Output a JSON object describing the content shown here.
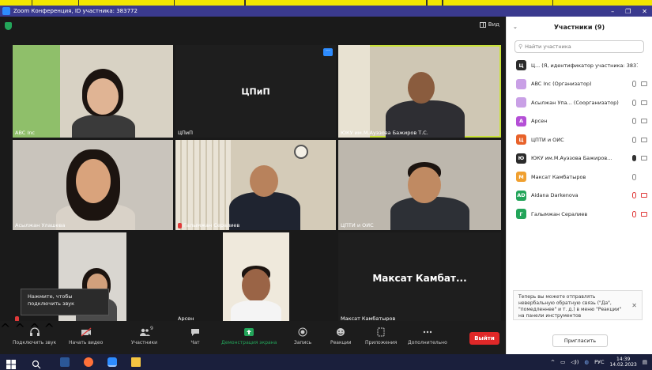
{
  "window": {
    "title": "Zoom Конференция, ID участника: 383772",
    "min": "–",
    "restore": "❐",
    "close": "✕"
  },
  "toolbar_top": {
    "view_label": "Вид"
  },
  "tiles": [
    {
      "name": "ABC Inc"
    },
    {
      "name": "ЦПиП",
      "big_label": "ЦПиП"
    },
    {
      "name": "ЮКУ  им.М.Ауэзова  Бажиров Т.С."
    },
    {
      "name": "Асылжан Улашева"
    },
    {
      "name": "Галымжан Сералиев"
    },
    {
      "name": "ЦПТИ и ОИС"
    },
    {
      "name": ""
    },
    {
      "name": "Арсен"
    },
    {
      "name": "Максат Камбатыров",
      "big_label": "Максат  Камбат..."
    }
  ],
  "tooltip": {
    "text": "Нажмите, чтобы подключить звук"
  },
  "controls": {
    "audio": "Подключить звук",
    "video": "Начать видео",
    "participants": "Участники",
    "participants_count": "9",
    "chat": "Чат",
    "share": "Демонстрация экрана",
    "record": "Запись",
    "reactions": "Реакции",
    "apps": "Приложения",
    "more": "Дополнительно",
    "leave": "Выйти"
  },
  "panel": {
    "title": "Участники (9)",
    "search_placeholder": "Найти участника",
    "participants": [
      {
        "initial": "Ц",
        "color": "#2b2b2b",
        "name": "Ц... (Я, идентификатор участника: 383772)"
      },
      {
        "initial": "",
        "color": "#c9a0e6",
        "name": "ABC Inc (Организатор)"
      },
      {
        "initial": "",
        "color": "#c9a0e6",
        "name": "Асылжан Упа...  (Соорганизатор)"
      },
      {
        "initial": "А",
        "color": "#b44fd6",
        "name": "Арсен"
      },
      {
        "initial": "Ц",
        "color": "#e8622a",
        "name": "ЦПТИ и ОИС"
      },
      {
        "initial": "Ю",
        "color": "#2b2b2b",
        "name": "ЮКУ  им.М.Ауэзова  Бажиров..."
      },
      {
        "initial": "М",
        "color": "#f0a030",
        "name": "Максат Камбатыров"
      },
      {
        "initial": "AD",
        "color": "#23a55a",
        "name": "Aidana Darkenova"
      },
      {
        "initial": "Г",
        "color": "#23a55a",
        "name": "Галымжан Сералиев"
      }
    ],
    "notice": "Теперь вы можете отправлять невербальную обратную связь (\"Да\", \"помедленнее\" и т. д.) в меню \"Реакции\" на панели инструментов",
    "invite": "Пригласить"
  },
  "taskbar": {
    "lang": "РУС",
    "time": "14:39",
    "date": "14.02.2023"
  }
}
